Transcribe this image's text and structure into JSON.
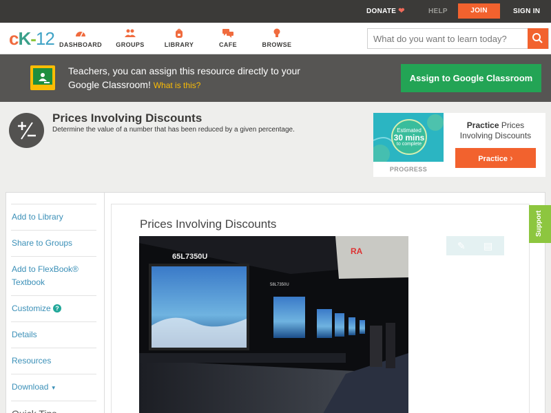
{
  "topbar": {
    "donate": "DONATE",
    "help": "HELP",
    "join": "JOIN",
    "sign_in": "SIGN IN"
  },
  "nav": {
    "items": [
      {
        "label": "DASHBOARD",
        "icon": "speedometer-icon"
      },
      {
        "label": "GROUPS",
        "icon": "people-icon"
      },
      {
        "label": "LIBRARY",
        "icon": "backpack-icon"
      },
      {
        "label": "CAFE",
        "icon": "chat-bubbles-icon"
      },
      {
        "label": "BROWSE",
        "icon": "lightbulb-icon"
      }
    ],
    "search_placeholder": "What do you want to learn today?"
  },
  "google_banner": {
    "text": "Teachers, you can assign this resource directly to your Google Classroom!",
    "what_is_this": "What is this?",
    "button": "Assign to Google Classroom"
  },
  "concept": {
    "title": "Prices Involving Discounts",
    "description": "Determine the value of a number that has been reduced by a given percentage."
  },
  "practice": {
    "estimated": "Estimated",
    "minutes": "30 mins",
    "to_complete": "to complete",
    "progress_label": "PROGRESS",
    "title_bold": "Practice",
    "title_rest": "Prices Involving Discounts",
    "button": "Practice"
  },
  "sidebar": {
    "items": [
      {
        "label": "Add to Library"
      },
      {
        "label": "Share to Groups"
      },
      {
        "label": "Add to FlexBook® Textbook"
      },
      {
        "label": "Customize"
      },
      {
        "label": "Details"
      },
      {
        "label": "Resources"
      },
      {
        "label": "Download"
      }
    ],
    "quick_tips": "Quick Tips"
  },
  "main": {
    "title": "Prices Involving Discounts",
    "image_text": [
      "65L7350U",
      "58L7350U"
    ]
  },
  "support": "Support",
  "colors": {
    "accent": "#f2622e",
    "google_green": "#23a455",
    "link": "#3a8fb7",
    "support": "#8dc63f"
  }
}
